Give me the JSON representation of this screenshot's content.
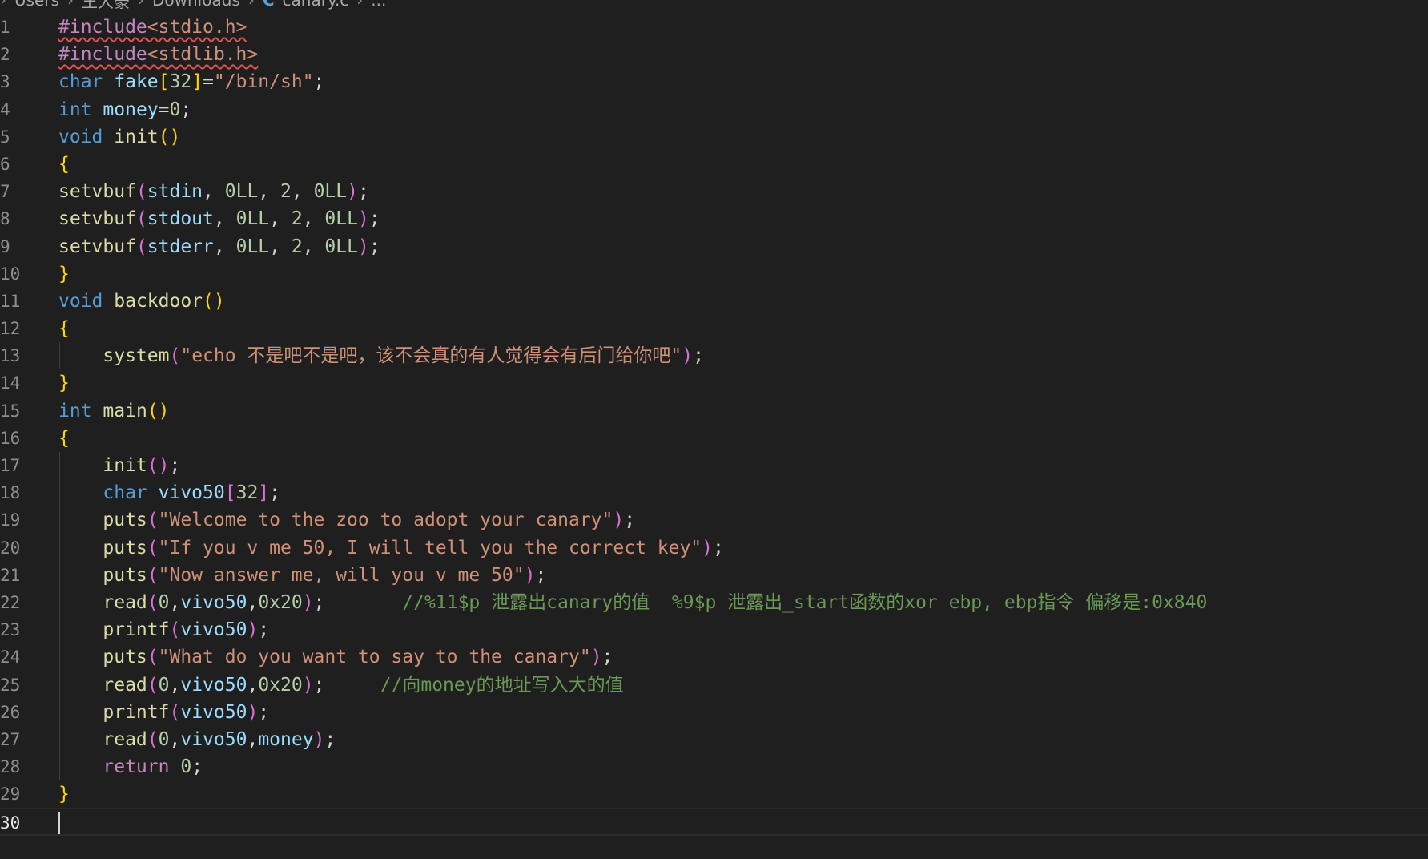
{
  "breadcrumb": {
    "items": [
      "Users",
      "王大豪",
      "Downloads"
    ],
    "file_icon": "C",
    "file": "canary.c",
    "more": "..."
  },
  "editor": {
    "current_line": 30,
    "lines": [
      {
        "n": "1",
        "tokens": [
          [
            "pp sq",
            "#include"
          ],
          [
            "hdr sq",
            "<stdio.h>"
          ]
        ]
      },
      {
        "n": "2",
        "tokens": [
          [
            "pp sq",
            "#include"
          ],
          [
            "hdr sq",
            "<stdlib.h>"
          ]
        ]
      },
      {
        "n": "3",
        "tokens": [
          [
            "kw",
            "char"
          ],
          [
            "pl",
            " "
          ],
          [
            "var",
            "fake"
          ],
          [
            "b1",
            "["
          ],
          [
            "num",
            "32"
          ],
          [
            "b1",
            "]"
          ],
          [
            "pl",
            "="
          ],
          [
            "str",
            "\"/bin/sh\""
          ],
          [
            "pl",
            ";"
          ]
        ]
      },
      {
        "n": "4",
        "tokens": [
          [
            "kw",
            "int"
          ],
          [
            "pl",
            " "
          ],
          [
            "var",
            "money"
          ],
          [
            "pl",
            "="
          ],
          [
            "num",
            "0"
          ],
          [
            "pl",
            ";"
          ]
        ]
      },
      {
        "n": "5",
        "tokens": [
          [
            "kw",
            "void"
          ],
          [
            "pl",
            " "
          ],
          [
            "fn",
            "init"
          ],
          [
            "b1",
            "()"
          ]
        ]
      },
      {
        "n": "6",
        "tokens": [
          [
            "b1",
            "{"
          ]
        ]
      },
      {
        "n": "7",
        "tokens": [
          [
            "fn",
            "setvbuf"
          ],
          [
            "b2",
            "("
          ],
          [
            "var",
            "stdin"
          ],
          [
            "pl",
            ", "
          ],
          [
            "num",
            "0LL"
          ],
          [
            "pl",
            ", "
          ],
          [
            "num",
            "2"
          ],
          [
            "pl",
            ", "
          ],
          [
            "num",
            "0LL"
          ],
          [
            "b2",
            ")"
          ],
          [
            "pl",
            ";"
          ]
        ]
      },
      {
        "n": "8",
        "tokens": [
          [
            "fn",
            "setvbuf"
          ],
          [
            "b2",
            "("
          ],
          [
            "var",
            "stdout"
          ],
          [
            "pl",
            ", "
          ],
          [
            "num",
            "0LL"
          ],
          [
            "pl",
            ", "
          ],
          [
            "num",
            "2"
          ],
          [
            "pl",
            ", "
          ],
          [
            "num",
            "0LL"
          ],
          [
            "b2",
            ")"
          ],
          [
            "pl",
            ";"
          ]
        ]
      },
      {
        "n": "9",
        "tokens": [
          [
            "fn",
            "setvbuf"
          ],
          [
            "b2",
            "("
          ],
          [
            "var",
            "stderr"
          ],
          [
            "pl",
            ", "
          ],
          [
            "num",
            "0LL"
          ],
          [
            "pl",
            ", "
          ],
          [
            "num",
            "2"
          ],
          [
            "pl",
            ", "
          ],
          [
            "num",
            "0LL"
          ],
          [
            "b2",
            ")"
          ],
          [
            "pl",
            ";"
          ]
        ]
      },
      {
        "n": "10",
        "tokens": [
          [
            "b1",
            "}"
          ]
        ]
      },
      {
        "n": "11",
        "tokens": [
          [
            "kw",
            "void"
          ],
          [
            "pl",
            " "
          ],
          [
            "fn",
            "backdoor"
          ],
          [
            "b1",
            "()"
          ]
        ]
      },
      {
        "n": "12",
        "tokens": [
          [
            "b1",
            "{"
          ]
        ]
      },
      {
        "n": "13",
        "guide": true,
        "tokens": [
          [
            "pl",
            "    "
          ],
          [
            "fn",
            "system"
          ],
          [
            "b2",
            "("
          ],
          [
            "str",
            "\"echo 不是吧不是吧，该不会真的有人觉得会有后门给你吧\""
          ],
          [
            "b2",
            ")"
          ],
          [
            "pl",
            ";"
          ]
        ]
      },
      {
        "n": "14",
        "tokens": [
          [
            "b1",
            "}"
          ]
        ]
      },
      {
        "n": "15",
        "tokens": [
          [
            "kw",
            "int"
          ],
          [
            "pl",
            " "
          ],
          [
            "fn",
            "main"
          ],
          [
            "b1",
            "()"
          ]
        ]
      },
      {
        "n": "16",
        "tokens": [
          [
            "b1",
            "{"
          ]
        ]
      },
      {
        "n": "17",
        "guide": true,
        "tokens": [
          [
            "pl",
            "    "
          ],
          [
            "fn",
            "init"
          ],
          [
            "b2",
            "()"
          ],
          [
            "pl",
            ";"
          ]
        ]
      },
      {
        "n": "18",
        "guide": true,
        "tokens": [
          [
            "pl",
            "    "
          ],
          [
            "kw",
            "char"
          ],
          [
            "pl",
            " "
          ],
          [
            "var",
            "vivo50"
          ],
          [
            "b2",
            "["
          ],
          [
            "num",
            "32"
          ],
          [
            "b2",
            "]"
          ],
          [
            "pl",
            ";"
          ]
        ]
      },
      {
        "n": "19",
        "guide": true,
        "tokens": [
          [
            "pl",
            "    "
          ],
          [
            "fn",
            "puts"
          ],
          [
            "b2",
            "("
          ],
          [
            "str",
            "\"Welcome to the zoo to adopt your canary\""
          ],
          [
            "b2",
            ")"
          ],
          [
            "pl",
            ";"
          ]
        ]
      },
      {
        "n": "20",
        "guide": true,
        "tokens": [
          [
            "pl",
            "    "
          ],
          [
            "fn",
            "puts"
          ],
          [
            "b2",
            "("
          ],
          [
            "str",
            "\"If you v me 50, I will tell you the correct key\""
          ],
          [
            "b2",
            ")"
          ],
          [
            "pl",
            ";"
          ]
        ]
      },
      {
        "n": "21",
        "guide": true,
        "tokens": [
          [
            "pl",
            "    "
          ],
          [
            "fn",
            "puts"
          ],
          [
            "b2",
            "("
          ],
          [
            "str",
            "\"Now answer me, will you v me 50\""
          ],
          [
            "b2",
            ")"
          ],
          [
            "pl",
            ";"
          ]
        ]
      },
      {
        "n": "22",
        "guide": true,
        "tokens": [
          [
            "pl",
            "    "
          ],
          [
            "fn",
            "read"
          ],
          [
            "b2",
            "("
          ],
          [
            "num",
            "0"
          ],
          [
            "pl",
            ","
          ],
          [
            "var",
            "vivo50"
          ],
          [
            "pl",
            ","
          ],
          [
            "num",
            "0x20"
          ],
          [
            "b2",
            ")"
          ],
          [
            "pl",
            ";       "
          ],
          [
            "cmt",
            "//%11$p 泄露出canary的值  %9$p 泄露出_start函数的xor ebp, ebp指令 偏移是:0x840"
          ]
        ]
      },
      {
        "n": "23",
        "guide": true,
        "tokens": [
          [
            "pl",
            "    "
          ],
          [
            "fn",
            "printf"
          ],
          [
            "b2",
            "("
          ],
          [
            "var",
            "vivo50"
          ],
          [
            "b2",
            ")"
          ],
          [
            "pl",
            ";"
          ]
        ]
      },
      {
        "n": "24",
        "guide": true,
        "tokens": [
          [
            "pl",
            "    "
          ],
          [
            "fn",
            "puts"
          ],
          [
            "b2",
            "("
          ],
          [
            "str",
            "\"What do you want to say to the canary\""
          ],
          [
            "b2",
            ")"
          ],
          [
            "pl",
            ";"
          ]
        ]
      },
      {
        "n": "25",
        "guide": true,
        "tokens": [
          [
            "pl",
            "    "
          ],
          [
            "fn",
            "read"
          ],
          [
            "b2",
            "("
          ],
          [
            "num",
            "0"
          ],
          [
            "pl",
            ","
          ],
          [
            "var",
            "vivo50"
          ],
          [
            "pl",
            ","
          ],
          [
            "num",
            "0x20"
          ],
          [
            "b2",
            ")"
          ],
          [
            "pl",
            ";     "
          ],
          [
            "cmt",
            "//向money的地址写入大的值"
          ]
        ]
      },
      {
        "n": "26",
        "guide": true,
        "tokens": [
          [
            "pl",
            "    "
          ],
          [
            "fn",
            "printf"
          ],
          [
            "b2",
            "("
          ],
          [
            "var",
            "vivo50"
          ],
          [
            "b2",
            ")"
          ],
          [
            "pl",
            ";"
          ]
        ]
      },
      {
        "n": "27",
        "guide": true,
        "tokens": [
          [
            "pl",
            "    "
          ],
          [
            "fn",
            "read"
          ],
          [
            "b2",
            "("
          ],
          [
            "num",
            "0"
          ],
          [
            "pl",
            ","
          ],
          [
            "var",
            "vivo50"
          ],
          [
            "pl",
            ","
          ],
          [
            "var",
            "money"
          ],
          [
            "b2",
            ")"
          ],
          [
            "pl",
            ";"
          ]
        ]
      },
      {
        "n": "28",
        "guide": true,
        "tokens": [
          [
            "pl",
            "    "
          ],
          [
            "ctl",
            "return"
          ],
          [
            "pl",
            " "
          ],
          [
            "num",
            "0"
          ],
          [
            "pl",
            ";"
          ]
        ]
      },
      {
        "n": "29",
        "tokens": [
          [
            "b1",
            "}"
          ]
        ]
      },
      {
        "n": "30",
        "tokens": []
      }
    ]
  },
  "colors": {
    "background": "#1f1f1f",
    "keyword": "#569cd6",
    "function": "#dcdcaa",
    "variable": "#9cdcfe",
    "string": "#ce9178",
    "number": "#b5cea8",
    "comment": "#6a9955",
    "preprocessor": "#c586c0",
    "bracket_level1": "#ffd700",
    "bracket_level2": "#da70d6"
  }
}
